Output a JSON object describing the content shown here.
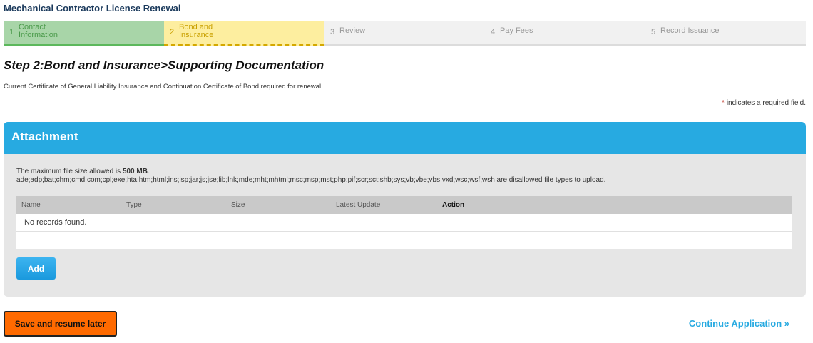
{
  "page_title": "Mechanical Contractor License Renewal",
  "steps": [
    {
      "num": "1",
      "label": "Contact Information",
      "state": "complete"
    },
    {
      "num": "2",
      "label": "Bond and Insurance",
      "state": "current"
    },
    {
      "num": "3",
      "label": "Review",
      "state": "pending"
    },
    {
      "num": "4",
      "label": "Pay Fees",
      "state": "pending"
    },
    {
      "num": "5",
      "label": "Record Issuance",
      "state": "pending"
    }
  ],
  "step_heading": "Step 2:Bond and Insurance>Supporting Documentation",
  "description": "Current Certificate of General Liability Insurance and Continuation Certificate of Bond required for renewal.",
  "required_note": {
    "star": "*",
    "text": "indicates a required field."
  },
  "attachment": {
    "title": "Attachment",
    "max_size_prefix": "The maximum file size allowed is ",
    "max_size_value": "500 MB",
    "max_size_suffix": ".",
    "disallowed_types": "ade;adp;bat;chm;cmd;com;cpl;exe;hta;htm;html;ins;isp;jar;js;jse;lib;lnk;mde;mht;mhtml;msc;msp;mst;php;pif;scr;sct;shb;sys;vb;vbe;vbs;vxd;wsc;wsf;wsh",
    "disallowed_suffix": " are disallowed file types to upload.",
    "columns": [
      "Name",
      "Type",
      "Size",
      "Latest Update",
      "Action"
    ],
    "empty_message": "No records found.",
    "add_label": "Add"
  },
  "save_label": "Save and resume later",
  "continue_label": "Continue Application »",
  "colors": {
    "accent": "#27aae1",
    "save": "#ff6a00",
    "complete": "#a8d5a8",
    "current": "#fdee9f"
  }
}
